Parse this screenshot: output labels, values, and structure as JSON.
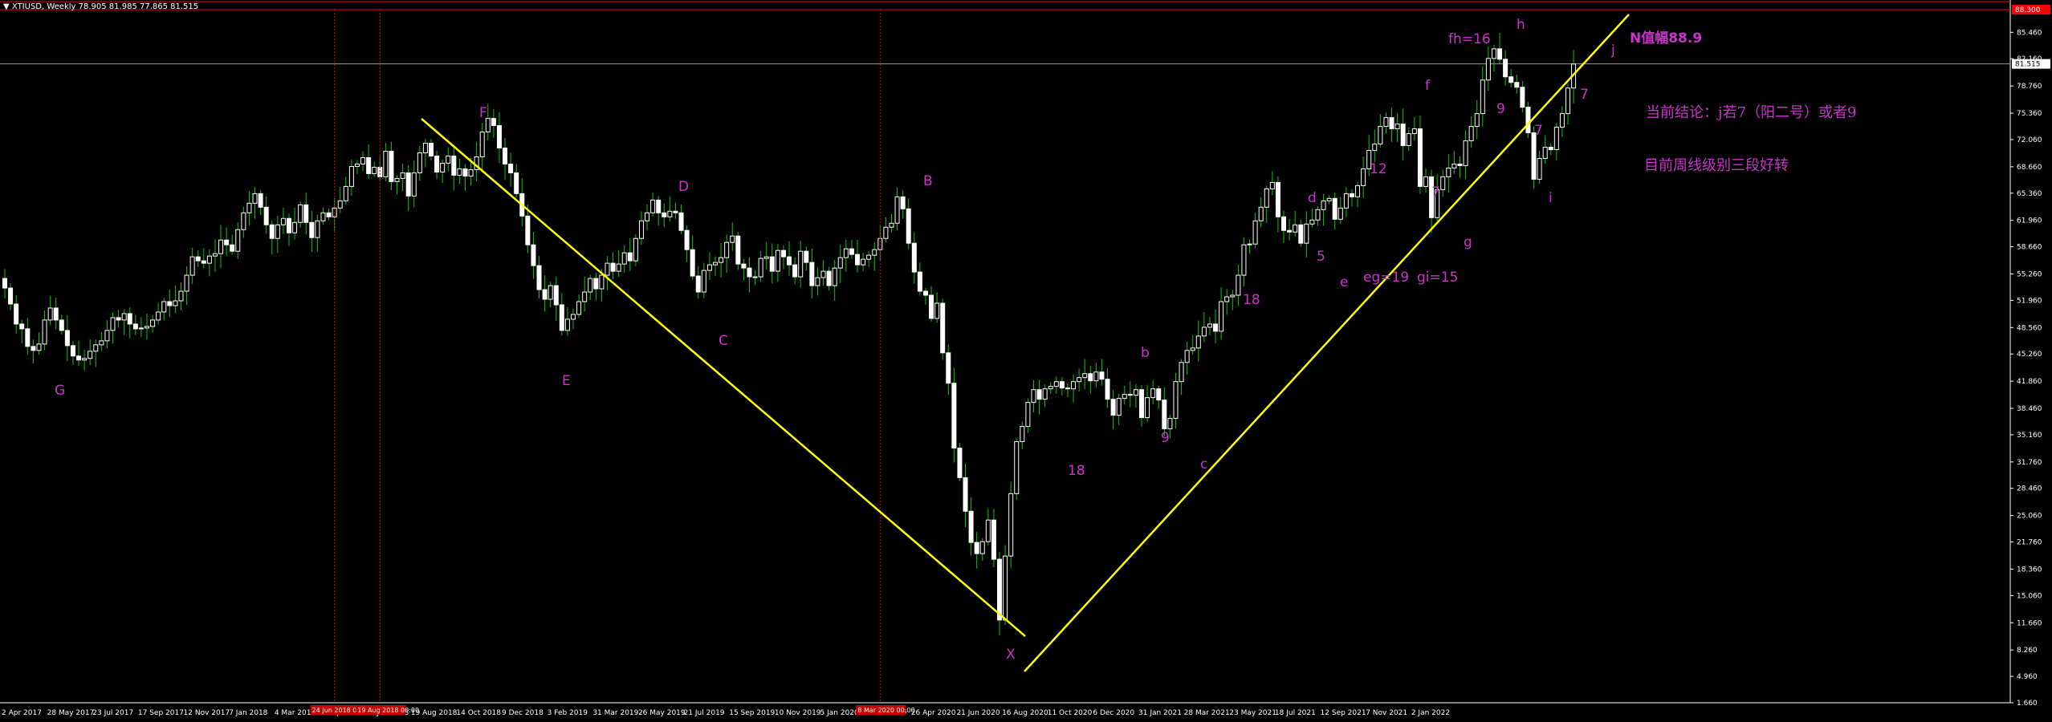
{
  "header": {
    "symbol": "XTIUSD, Weekly",
    "ohlc": "78.905 81.985 77.865 81.515"
  },
  "notes": {
    "n_value": "N值幅88.9",
    "conclusion": "当前结论：j若7（阳二号）或者9",
    "weekly_note": "目前周线级别三段好转"
  },
  "colors": {
    "background": "#000000",
    "bull_candle": "#ffffff",
    "bear_candle": "#ffffff",
    "wick": "#00cc00",
    "trendline": "#ffff00",
    "label": "#cc33cc",
    "grid_vline": "#cc0000",
    "price_line": "#999999",
    "top_line": "#ff0000"
  },
  "chart_data": {
    "type": "candlestick",
    "title": "XTIUSD, Weekly",
    "ylim": [
      1.66,
      88.3
    ],
    "price_axis_ticks": [
      "85.460",
      "82.160",
      "78.760",
      "75.360",
      "72.060",
      "68.660",
      "65.360",
      "61.960",
      "58.660",
      "55.260",
      "51.960",
      "48.560",
      "45.260",
      "41.860",
      "38.460",
      "35.160",
      "31.760",
      "28.460",
      "25.060",
      "21.760",
      "18.360",
      "15.060",
      "11.660",
      "8.260",
      "4.960",
      "1.660"
    ],
    "current_price": 81.515,
    "current_price_label": "81.515",
    "top_price_label": "88.300",
    "date_ticks": [
      "2 Apr 2017",
      "28 May 2017",
      "23 Jul 2017",
      "17 Sep 2017",
      "12 Nov 2017",
      "7 Jan 2018",
      "4 Mar 2018",
      "29 Apr 2018",
      "24 Jun 2018",
      "19 Aug 2018",
      "14 Oct 2018",
      "9 Dec 2018",
      "3 Feb 2019",
      "31 Mar 2019",
      "26 May 2019",
      "21 Jul 2019",
      "15 Sep 2019",
      "10 Nov 2019",
      "5 Jan 2020",
      "1 Mar 2020",
      "26 Apr 2020",
      "21 Jun 2020",
      "16 Aug 2020",
      "11 Oct 2020",
      "6 Dec 2020",
      "31 Jan 2021",
      "28 Mar 2021",
      "23 May 2021",
      "18 Jul 2021",
      "12 Sep 2021",
      "7 Nov 2021",
      "2 Jan 2022"
    ],
    "highlighted_dates": [
      "24 Jun 2018 00:00",
      "19 Aug 2018 00:00",
      "8 Mar 2020 00:00"
    ],
    "closes": [
      53.5,
      51.5,
      49.0,
      48.4,
      46.2,
      45.7,
      46.5,
      49.5,
      51.0,
      49.5,
      48.2,
      46.3,
      45.0,
      44.5,
      44.7,
      45.6,
      46.4,
      46.9,
      48.2,
      49.8,
      49.5,
      50.3,
      49.0,
      48.4,
      48.5,
      48.7,
      49.5,
      50.5,
      51.8,
      51.3,
      51.9,
      53.1,
      55.1,
      57.4,
      56.9,
      56.6,
      57.5,
      57.8,
      59.5,
      58.9,
      58.1,
      60.8,
      62.9,
      64.1,
      65.3,
      63.6,
      61.4,
      59.7,
      61.4,
      62.2,
      60.4,
      61.7,
      63.9,
      61.7,
      59.8,
      61.9,
      62.9,
      62.4,
      63.5,
      64.4,
      66.2,
      68.7,
      69.0,
      69.8,
      67.8,
      68.6,
      67.4,
      70.6,
      66.8,
      67.2,
      67.9,
      65.0,
      67.9,
      70.4,
      71.6,
      70.0,
      68.0,
      69.1,
      70.0,
      67.6,
      68.4,
      67.5,
      68.3,
      69.9,
      73.0,
      74.7,
      73.8,
      71.0,
      69.0,
      67.9,
      65.3,
      62.5,
      58.9,
      56.3,
      53.3,
      52.1,
      53.8,
      51.4,
      48.2,
      49.6,
      50.2,
      51.8,
      53.0,
      54.7,
      53.4,
      55.1,
      56.6,
      55.6,
      56.5,
      57.9,
      56.9,
      59.7,
      61.9,
      62.9,
      64.5,
      62.9,
      62.4,
      63.1,
      62.9,
      60.7,
      58.3,
      55.0,
      53.0,
      55.7,
      56.4,
      56.7,
      57.3,
      59.2,
      60.0,
      56.5,
      56.0,
      54.9,
      54.9,
      57.2,
      57.4,
      55.6,
      58.2,
      57.4,
      56.4,
      54.9,
      58.1,
      56.7,
      53.8,
      54.8,
      55.6,
      53.8,
      56.0,
      57.3,
      58.4,
      57.7,
      56.4,
      57.1,
      57.6,
      58.3,
      59.7,
      61.1,
      61.6,
      64.9,
      63.4,
      59.1,
      55.5,
      53.1,
      52.6,
      49.7,
      51.6,
      45.4,
      41.6,
      33.5,
      29.8,
      25.6,
      21.7,
      20.3,
      21.8,
      24.5,
      19.6,
      12.0,
      20.0,
      27.8,
      34.3,
      36.2,
      39.2,
      40.8,
      39.6,
      40.9,
      41.2,
      41.8,
      41.0,
      40.9,
      41.8,
      42.3,
      42.8,
      41.9,
      43.0,
      42.1,
      39.6,
      37.6,
      39.7,
      40.2,
      40.1,
      40.8,
      37.3,
      39.8,
      40.9,
      39.5,
      35.9,
      37.2,
      41.8,
      44.2,
      45.7,
      46.0,
      47.5,
      48.6,
      49.0,
      48.1,
      51.8,
      52.4,
      52.6,
      55.1,
      58.9,
      59.0,
      61.9,
      63.6,
      65.9,
      66.7,
      62.4,
      60.7,
      60.5,
      61.4,
      59.1,
      61.5,
      62.0,
      63.3,
      64.4,
      64.7,
      62.1,
      63.5,
      65.3,
      64.9,
      66.3,
      68.4,
      70.7,
      71.5,
      73.7,
      74.8,
      73.4,
      74.0,
      71.3,
      72.8,
      73.4,
      66.2,
      67.4,
      62.3,
      65.8,
      67.4,
      68.5,
      69.0,
      68.8,
      71.9,
      73.7,
      75.3,
      79.5,
      82.2,
      83.4,
      82.1,
      79.9,
      79.2,
      78.6,
      76.1,
      72.9,
      67.1,
      69.7,
      71.1,
      70.8,
      73.6,
      75.3,
      78.5,
      81.5
    ],
    "wave_labels": [
      "G",
      "F",
      "E",
      "D",
      "C",
      "B",
      "X",
      "18",
      "b",
      "9",
      "c",
      "18",
      "d",
      "5",
      "e",
      "eg=19",
      "gi=15",
      "12",
      "7",
      "f",
      "fh=16",
      "9",
      "g",
      "h",
      "7",
      "i",
      "7",
      "j"
    ],
    "trendlines": [
      {
        "name": "F-X line",
        "from": {
          "date": "13 May 2018",
          "price": 74.6
        },
        "to": {
          "date": "12 Apr 2020",
          "price": 11.3
        }
      },
      {
        "name": "X-j line",
        "from": {
          "date": "19 Apr 2020",
          "price": 6.8
        },
        "to": {
          "date": "9 Jan 2022",
          "price": 88.3
        }
      }
    ]
  }
}
